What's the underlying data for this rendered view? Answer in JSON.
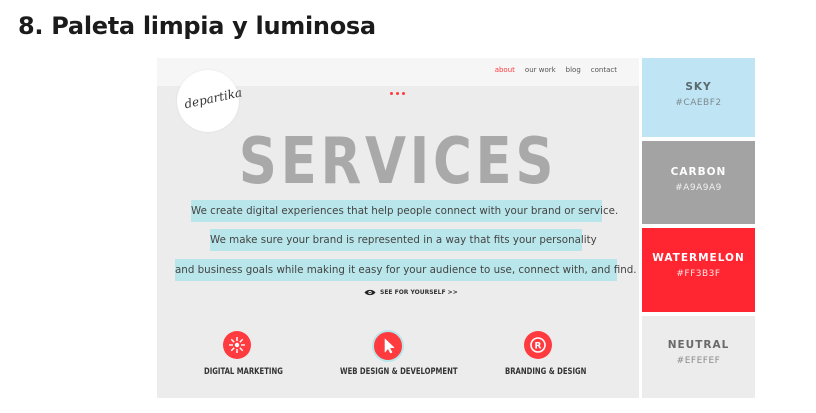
{
  "heading": "8. Paleta limpia y luminosa",
  "site": {
    "logo": "departika",
    "nav": [
      "about",
      "our work",
      "blog",
      "contact"
    ],
    "active_nav": "about",
    "title": "SERVICES",
    "lines": [
      "We create digital experiences that help people connect with your brand or service.",
      "We make sure your brand is represented in a way that fits your personality",
      "and business goals while making it easy for your audience to use, connect with, and find."
    ],
    "cta": "SEE FOR YOURSELF >>",
    "services": [
      "DIGITAL MARKETING",
      "WEB DESIGN & DEVELOPMENT",
      "BRANDING & DESIGN"
    ]
  },
  "swatches": [
    {
      "name": "SKY",
      "hex": "#CAEBF2",
      "bg": "#bfe4f3",
      "name_color": "#5a6870",
      "hex_color": "#7d8b92"
    },
    {
      "name": "CARBON",
      "hex": "#A9A9A9",
      "bg": "#a3a3a3",
      "name_color": "#ffffff",
      "hex_color": "#f0f0f0"
    },
    {
      "name": "WATERMELON",
      "hex": "#FF3B3F",
      "bg": "#ff2631",
      "name_color": "#ffffff",
      "hex_color": "#ffe3e3"
    },
    {
      "name": "NEUTRAL",
      "hex": "#EFEFEF",
      "bg": "#ececec",
      "name_color": "#6a6a6a",
      "hex_color": "#8a8a8a"
    }
  ]
}
